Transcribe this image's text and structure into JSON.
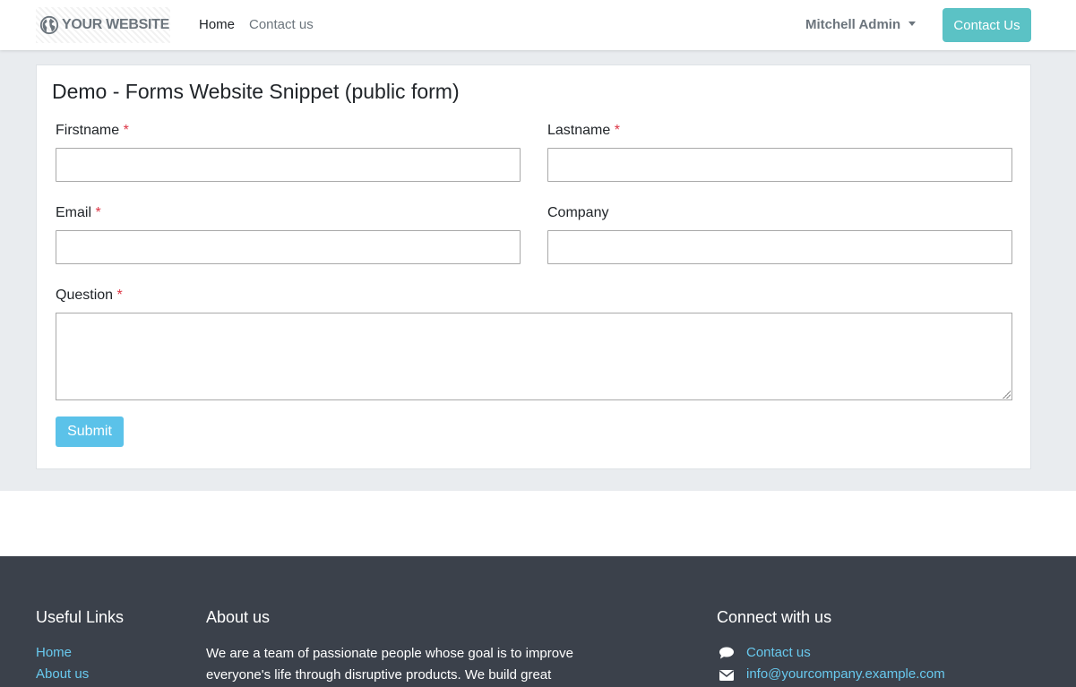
{
  "header": {
    "logo_text": "YOUR WEBSITE",
    "nav": {
      "home": "Home",
      "contact": "Contact us"
    },
    "user_menu": "Mitchell Admin",
    "contact_button": "Contact Us"
  },
  "form": {
    "title": "Demo - Forms Website Snippet (public form)",
    "required_mark": "*",
    "fields": {
      "firstname": {
        "label": "Firstname",
        "value": "",
        "required": true
      },
      "lastname": {
        "label": "Lastname",
        "value": "",
        "required": true
      },
      "email": {
        "label": "Email",
        "value": "",
        "required": true
      },
      "company": {
        "label": "Company",
        "value": "",
        "required": false
      },
      "question": {
        "label": "Question",
        "value": "",
        "required": true
      }
    },
    "submit_label": "Submit"
  },
  "footer": {
    "useful_links": {
      "title": "Useful Links",
      "items": [
        "Home",
        "About us"
      ]
    },
    "about": {
      "title": "About us",
      "text": "We are a team of passionate people whose goal is to improve everyone's life through disruptive products. We build great"
    },
    "connect": {
      "title": "Connect with us",
      "items": [
        {
          "icon": "comment-icon",
          "label": "Contact us"
        },
        {
          "icon": "envelope-icon",
          "label": "info@yourcompany.example.com"
        }
      ]
    }
  },
  "colors": {
    "accent": "#5bc2c5",
    "submit": "#5bc2e9",
    "required": "#dc3545",
    "footer_bg": "#3b414b",
    "footer_link": "#68c9ee",
    "page_bg": "#e9ecef"
  }
}
